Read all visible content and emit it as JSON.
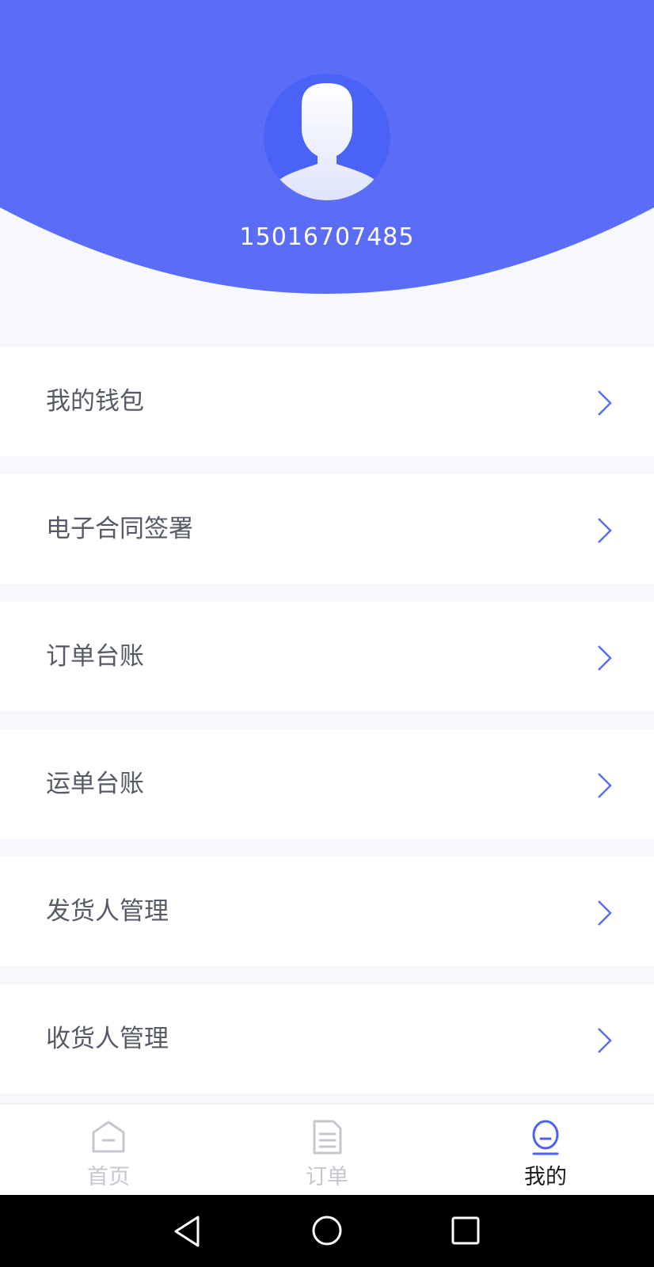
{
  "profile": {
    "phone": "15016707485"
  },
  "colors": {
    "header_bg": "#5b6cf6",
    "avatar_bg": "#4a63f6",
    "chevron": "#5b6cf6",
    "tab_active_icon": "#4a63f6"
  },
  "menu": {
    "items": [
      {
        "label": "我的钱包",
        "icon": "chevron-right-icon"
      },
      {
        "label": "电子合同签署",
        "icon": "chevron-right-icon"
      },
      {
        "label": "订单台账",
        "icon": "chevron-right-icon"
      },
      {
        "label": "运单台账",
        "icon": "chevron-right-icon"
      },
      {
        "label": "发货人管理",
        "icon": "chevron-right-icon"
      },
      {
        "label": "收货人管理",
        "icon": "chevron-right-icon"
      }
    ]
  },
  "tabbar": {
    "tabs": [
      {
        "label": "首页",
        "icon": "home-icon",
        "active": false
      },
      {
        "label": "订单",
        "icon": "document-icon",
        "active": false
      },
      {
        "label": "我的",
        "icon": "profile-icon",
        "active": true
      }
    ]
  },
  "system_nav": {
    "back": "back-triangle-icon",
    "home": "home-circle-icon",
    "recents": "recents-square-icon"
  }
}
